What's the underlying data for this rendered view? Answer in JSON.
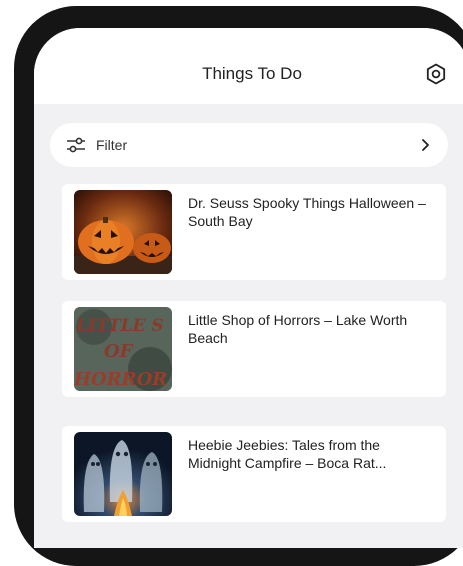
{
  "header": {
    "title": "Things To Do",
    "settings_icon": "settings-hexagon-icon"
  },
  "filter": {
    "label": "Filter",
    "icon": "sliders-icon",
    "chevron": "chevron-right-icon"
  },
  "events": [
    {
      "title": "Dr. Seuss Spooky Things Halloween – South Bay",
      "image": "jack-o-lanterns"
    },
    {
      "title": "Little Shop of Horrors – Lake Worth Beach",
      "image": "little-shop-of-horrors-poster",
      "image_text": [
        "LITTLE S",
        "OF",
        "HORROR"
      ]
    },
    {
      "title": "Heebie Jeebies: Tales from the Midnight Campfire – Boca Rat...",
      "image": "ghosts-around-campfire"
    }
  ],
  "colors": {
    "background": "#f1f1f3",
    "card": "#ffffff",
    "phone_frame": "#151515"
  }
}
